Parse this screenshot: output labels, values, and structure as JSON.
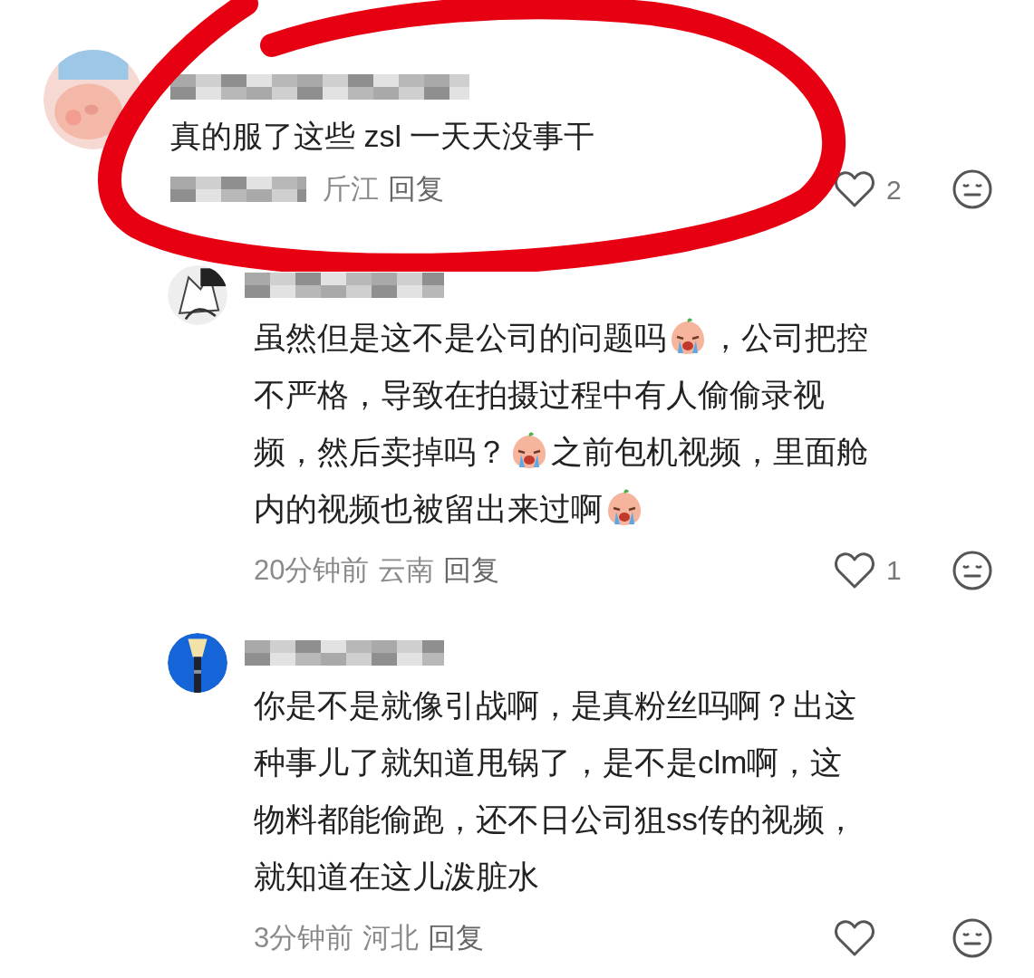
{
  "comments": [
    {
      "avatar": {
        "kind": "picture"
      },
      "lines": [
        [
          {
            "kind": "text",
            "text": "真的服了这些 zsl 一天天没事干"
          }
        ]
      ],
      "meta": [
        "斤江",
        "回复"
      ],
      "likes": "2",
      "children": [
        {
          "avatar": {
            "kind": "picture"
          },
          "lines": [
            [
              {
                "kind": "text",
                "text": "虽然但是这不是公司的问题吗"
              },
              {
                "kind": "emoji"
              },
              {
                "kind": "text",
                "text": "，公司把控"
              }
            ],
            [
              {
                "kind": "text",
                "text": "不严格，导致在拍摄过程中有人偷偷录视"
              }
            ],
            [
              {
                "kind": "text",
                "text": "频，然后卖掉吗？"
              },
              {
                "kind": "emoji"
              },
              {
                "kind": "text",
                "text": "之前包机视频，里面舱"
              }
            ],
            [
              {
                "kind": "text",
                "text": "内的视频也被留出来过啊"
              },
              {
                "kind": "emoji"
              }
            ]
          ],
          "meta": [
            "20分钟前",
            "云南",
            "回复"
          ],
          "likes": "1"
        },
        {
          "avatar": {
            "kind": "picture"
          },
          "lines": [
            [
              {
                "kind": "text",
                "text": "你是不是就像引战啊，是真粉丝吗啊？出这"
              }
            ],
            [
              {
                "kind": "text",
                "text": "种事儿了就知道甩锅了，是不是clm啊，这"
              }
            ],
            [
              {
                "kind": "text",
                "text": "物料都能偷跑，还不日公司狙ss传的视频，"
              }
            ],
            [
              {
                "kind": "text",
                "text": "就知道在这儿泼脏水"
              }
            ]
          ],
          "meta": [
            "3分钟前",
            "河北",
            "回复"
          ]
        }
      ]
    }
  ]
}
